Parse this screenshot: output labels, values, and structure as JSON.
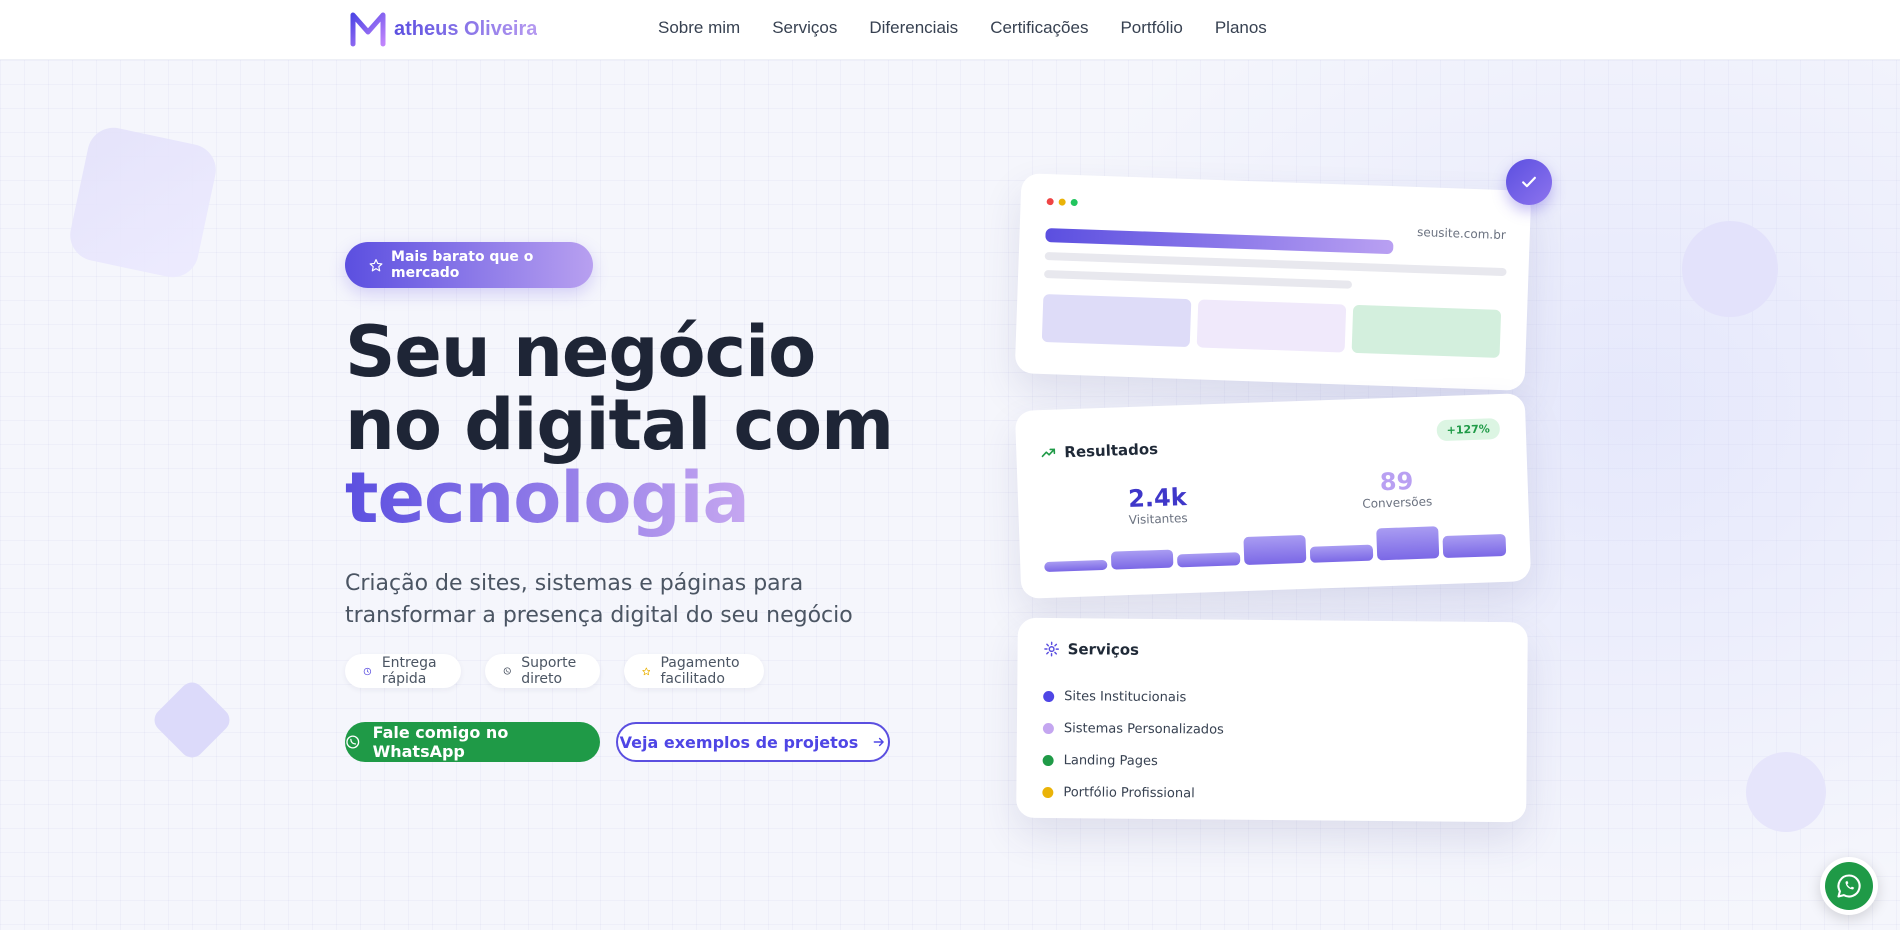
{
  "brand": {
    "name": "atheus Oliveira"
  },
  "nav": {
    "items": [
      "Sobre mim",
      "Serviços",
      "Diferenciais",
      "Certificações",
      "Portfólio",
      "Planos"
    ]
  },
  "hero": {
    "badge": "Mais barato que o mercado",
    "title_line1": "Seu negócio",
    "title_line2": "no digital com",
    "title_highlight": "tecnologia",
    "subtitle": "Criação de sites, sistemas e páginas para transformar a presença digital do seu negócio",
    "chips": [
      {
        "label": "Entrega rápida",
        "icon": "clock-icon"
      },
      {
        "label": "Suporte direto",
        "icon": "whatsapp-icon"
      },
      {
        "label": "Pagamento facilitado",
        "icon": "star-icon"
      }
    ],
    "cta_primary": "Fale comigo no WhatsApp",
    "cta_secondary": "Veja exemplos de projetos"
  },
  "preview_card": {
    "url": "seusite.com.br"
  },
  "results_card": {
    "title": "Resultados",
    "growth": "+127%",
    "visitors_value": "2.4k",
    "visitors_label": "Visitantes",
    "conversions_value": "89",
    "conversions_label": "Conversões"
  },
  "services_card": {
    "title": "Serviços",
    "items": [
      {
        "label": "Sites Institucionais",
        "color": "#4f46e5"
      },
      {
        "label": "Sistemas Personalizados",
        "color": "#c4a6f0"
      },
      {
        "label": "Landing Pages",
        "color": "#1f9a47"
      },
      {
        "label": "Portfólio Profissional",
        "color": "#eab308"
      }
    ]
  },
  "colors": {
    "accent": "#5b4fe0",
    "accent_light": "#b9a0f2",
    "whatsapp": "#1f9a47"
  }
}
